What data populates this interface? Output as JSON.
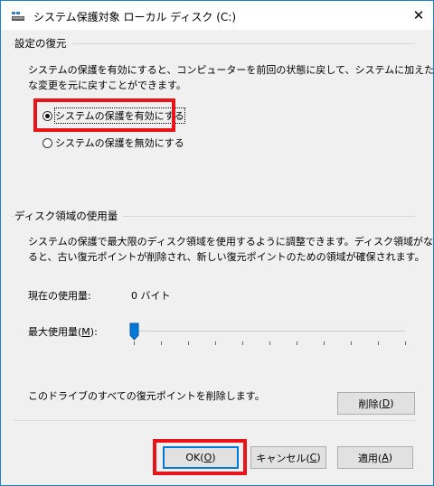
{
  "window": {
    "title": "システム保護対象 ローカル ディスク (C:)",
    "close_glyph": "✕"
  },
  "restore_group": {
    "label": "設定の復元",
    "description_line1": "システムの保護を有効にすると、コンピューターを前回の状態に戻して、システムに加えた不要",
    "description_line2": "な変更を元に戻すことができます。",
    "options": [
      {
        "label": "システムの保護を有効にする",
        "selected": true
      },
      {
        "label": "システムの保護を無効にする",
        "selected": false
      }
    ]
  },
  "disk_group": {
    "label": "ディスク領域の使用量",
    "description_line1": "システムの保護で最大限のディスク領域を使用するように調整できます。ディスク領域がなくな",
    "description_line2": "ると、古い復元ポイントが削除され、新しい復元ポイントのための領域が確保されます。",
    "current_usage_label": "現在の使用量:",
    "current_usage_value": "0 バイト",
    "max_usage_label_pre": "最大使用量(",
    "max_usage_label_key": "M",
    "max_usage_label_post": "):",
    "max_usage_fraction": 0.0,
    "delete_text": "このドライブのすべての復元ポイントを削除します。",
    "delete_button": {
      "pre": "削除(",
      "key": "D",
      "post": ")"
    }
  },
  "footer": {
    "ok": {
      "pre": "OK(",
      "key": "O",
      "post": ")"
    },
    "cancel": {
      "pre": "キャンセル(",
      "key": "C",
      "post": ")"
    },
    "apply": {
      "pre": "適用(",
      "key": "A",
      "post": ")"
    }
  },
  "colors": {
    "highlight_box": "#e8141a",
    "default_button_border": "#0078d7",
    "slider_thumb": "#0078d7"
  }
}
